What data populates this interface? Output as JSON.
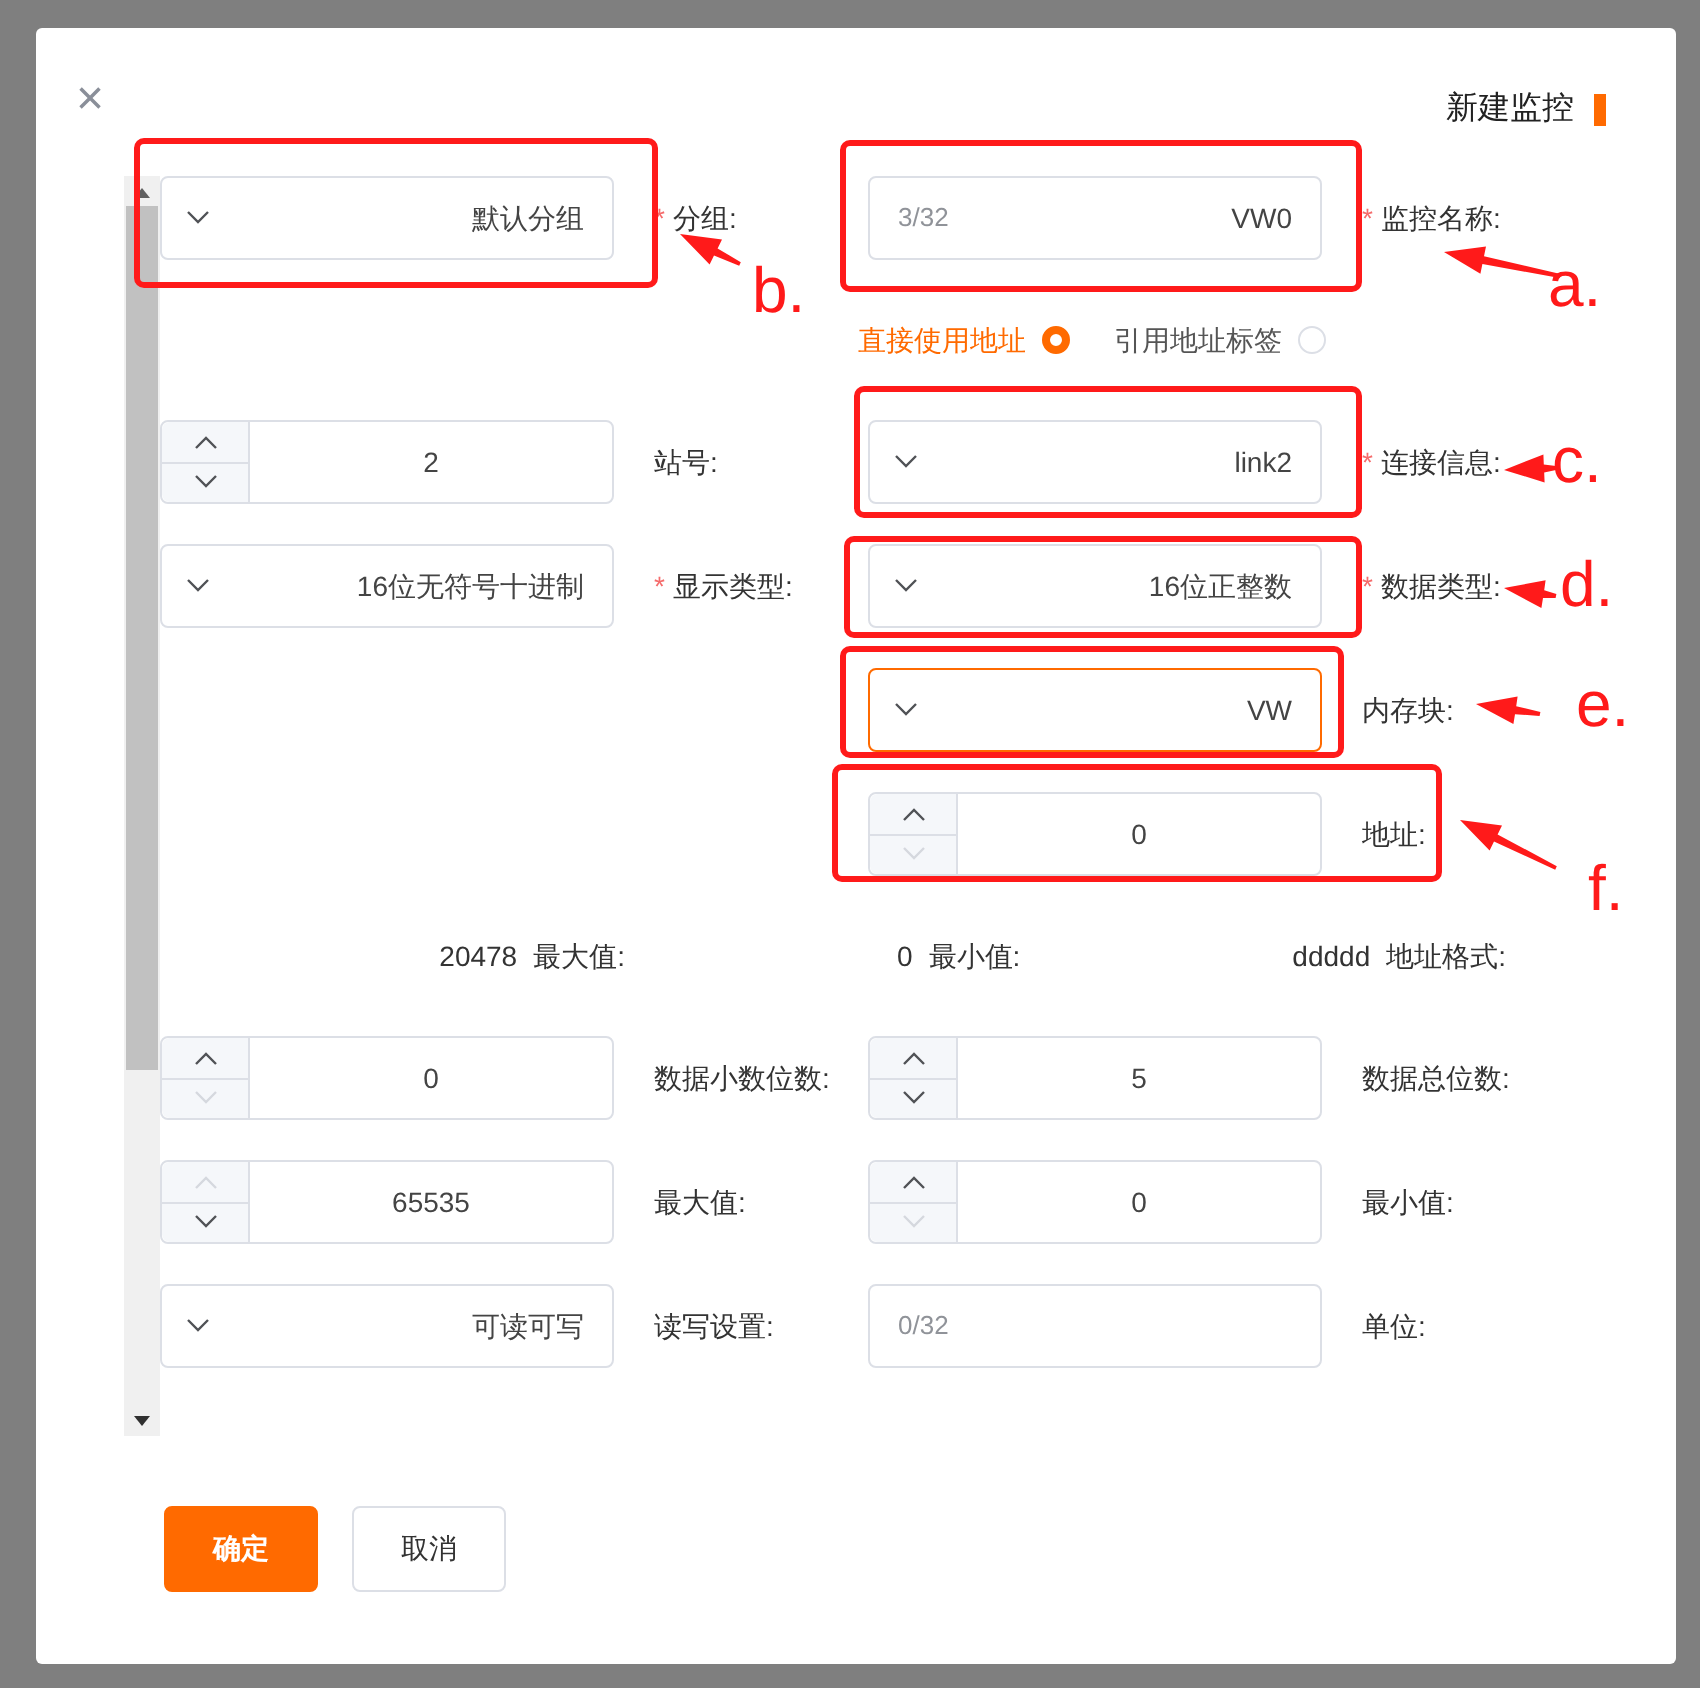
{
  "dialog": {
    "title": "新建监控",
    "close": "×"
  },
  "rows": [
    {
      "kind": "fields",
      "cells": [
        {
          "kind": "select",
          "value": "默认分组"
        },
        {
          "kind": "label",
          "text": "分组:",
          "required_mark": "*"
        },
        {
          "kind": "text",
          "value": "VW0",
          "counter": "3/32"
        },
        {
          "kind": "label",
          "text": "监控名称:",
          "required_mark": "*"
        }
      ]
    },
    {
      "kind": "radio",
      "options": [
        {
          "label": "直接使用地址",
          "selected": true
        },
        {
          "label": "引用地址标签",
          "selected": false
        }
      ]
    },
    {
      "kind": "fields",
      "cells": [
        {
          "kind": "number",
          "value": "2",
          "increment_disabled": false,
          "decrement_disabled": false
        },
        {
          "kind": "label",
          "text": "站号:"
        },
        {
          "kind": "select",
          "value": "link2"
        },
        {
          "kind": "label",
          "text": "连接信息:",
          "required_mark": "*"
        }
      ]
    },
    {
      "kind": "fields",
      "cells": [
        {
          "kind": "select",
          "value": "16位无符号十进制"
        },
        {
          "kind": "label",
          "text": "显示类型:",
          "required_mark": "*"
        },
        {
          "kind": "select",
          "value": "16位正整数"
        },
        {
          "kind": "label",
          "text": "数据类型:",
          "required_mark": "*"
        }
      ]
    },
    {
      "kind": "fields",
      "cells": [
        {
          "kind": "select",
          "value": "VW",
          "focused": true
        },
        {
          "kind": "label",
          "text": "内存块:"
        }
      ]
    },
    {
      "kind": "fields",
      "cells": [
        {
          "kind": "number",
          "value": "0",
          "increment_disabled": false,
          "decrement_disabled": true
        },
        {
          "kind": "label",
          "text": "地址:"
        }
      ]
    },
    {
      "kind": "info",
      "items": [
        {
          "label": "最大值:",
          "value": "20478"
        },
        {
          "label": "最小值:",
          "value": "0"
        },
        {
          "label": "地址格式:",
          "value": "ddddd"
        }
      ]
    },
    {
      "kind": "fields",
      "cells": [
        {
          "kind": "number",
          "value": "0",
          "increment_disabled": false,
          "decrement_disabled": true
        },
        {
          "kind": "label",
          "text": "数据小数位数:"
        },
        {
          "kind": "number",
          "value": "5",
          "increment_disabled": false,
          "decrement_disabled": false
        },
        {
          "kind": "label",
          "text": "数据总位数:"
        }
      ]
    },
    {
      "kind": "fields",
      "cells": [
        {
          "kind": "number",
          "value": "65535",
          "increment_disabled": true,
          "decrement_disabled": false
        },
        {
          "kind": "label",
          "text": "最大值:"
        },
        {
          "kind": "number",
          "value": "0",
          "increment_disabled": false,
          "decrement_disabled": true
        },
        {
          "kind": "label",
          "text": "最小值:"
        }
      ]
    },
    {
      "kind": "fields",
      "cells": [
        {
          "kind": "select",
          "value": "可读可写"
        },
        {
          "kind": "label",
          "text": "读写设置:"
        },
        {
          "kind": "text",
          "counter": "0/32"
        },
        {
          "kind": "label",
          "text": "单位:"
        }
      ]
    }
  ],
  "buttons": [
    {
      "label": "确定",
      "kind": "primary"
    },
    {
      "label": "取消",
      "kind": "secondary"
    }
  ],
  "annotations": [
    {
      "label": "b."
    },
    {
      "label": "a."
    },
    {
      "label": "c."
    },
    {
      "label": "d."
    },
    {
      "label": "e."
    },
    {
      "label": "f."
    }
  ]
}
